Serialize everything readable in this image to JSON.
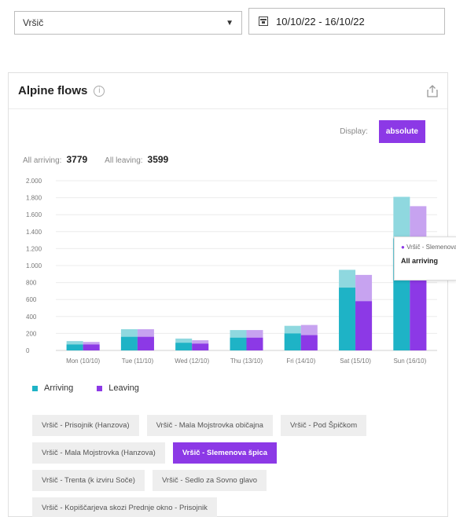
{
  "filters": {
    "location_value": "Vršič",
    "date_range": "10/10/22 - 16/10/22"
  },
  "card": {
    "title": "Alpine flows",
    "display_label": "Display:",
    "display_button": "absolute",
    "totals": {
      "arriving_label": "All arriving:",
      "arriving_value": "3779",
      "leaving_label": "All leaving:",
      "leaving_value": "3599"
    }
  },
  "colors": {
    "arriving": "#1eb3c6",
    "arriving_light": "#8fd8df",
    "leaving": "#8c39e6",
    "leaving_light": "#c7a3f0"
  },
  "chart_data": {
    "type": "bar",
    "categories": [
      "Mon (10/10)",
      "Tue (11/10)",
      "Wed (12/10)",
      "Thu (13/10)",
      "Fri (14/10)",
      "Sat (15/10)",
      "Sun (16/10)"
    ],
    "y_ticks": [
      "0",
      "200",
      "400",
      "600",
      "800",
      "1.000",
      "1.200",
      "1.400",
      "1.600",
      "1.800",
      "2.000"
    ],
    "ylim": [
      0,
      2000
    ],
    "grid": true,
    "series": [
      {
        "name": "Arriving",
        "total": [
          110,
          250,
          140,
          240,
          290,
          950,
          1810
        ],
        "highlight": [
          70,
          160,
          90,
          150,
          200,
          740,
          1320
        ]
      },
      {
        "name": "Leaving",
        "total": [
          100,
          250,
          120,
          240,
          300,
          890,
          1700
        ],
        "highlight": [
          70,
          160,
          80,
          150,
          180,
          580,
          1300
        ]
      }
    ]
  },
  "tooltip": {
    "series": "Vršič - Slemenova špica",
    "label": "All arriving"
  },
  "legend": {
    "arriving": "Arriving",
    "leaving": "Leaving"
  },
  "chips": [
    {
      "label": "Vršič - Prisojnik (Hanzova)",
      "active": false
    },
    {
      "label": "Vršič - Mala Mojstrovka običajna",
      "active": false
    },
    {
      "label": "Vršič - Pod Špičkom",
      "active": false
    },
    {
      "label": "Vršič - Mala Mojstrovka (Hanzova)",
      "active": false
    },
    {
      "label": "Vršič - Slemenova špica",
      "active": true
    },
    {
      "label": "Vršič - Trenta (k izviru Soče)",
      "active": false
    },
    {
      "label": "Vršič - Sedlo za Sovno glavo",
      "active": false
    },
    {
      "label": "Vršič - Kopiščarjeva skozi Prednje okno - Prisojnik",
      "active": false
    }
  ]
}
